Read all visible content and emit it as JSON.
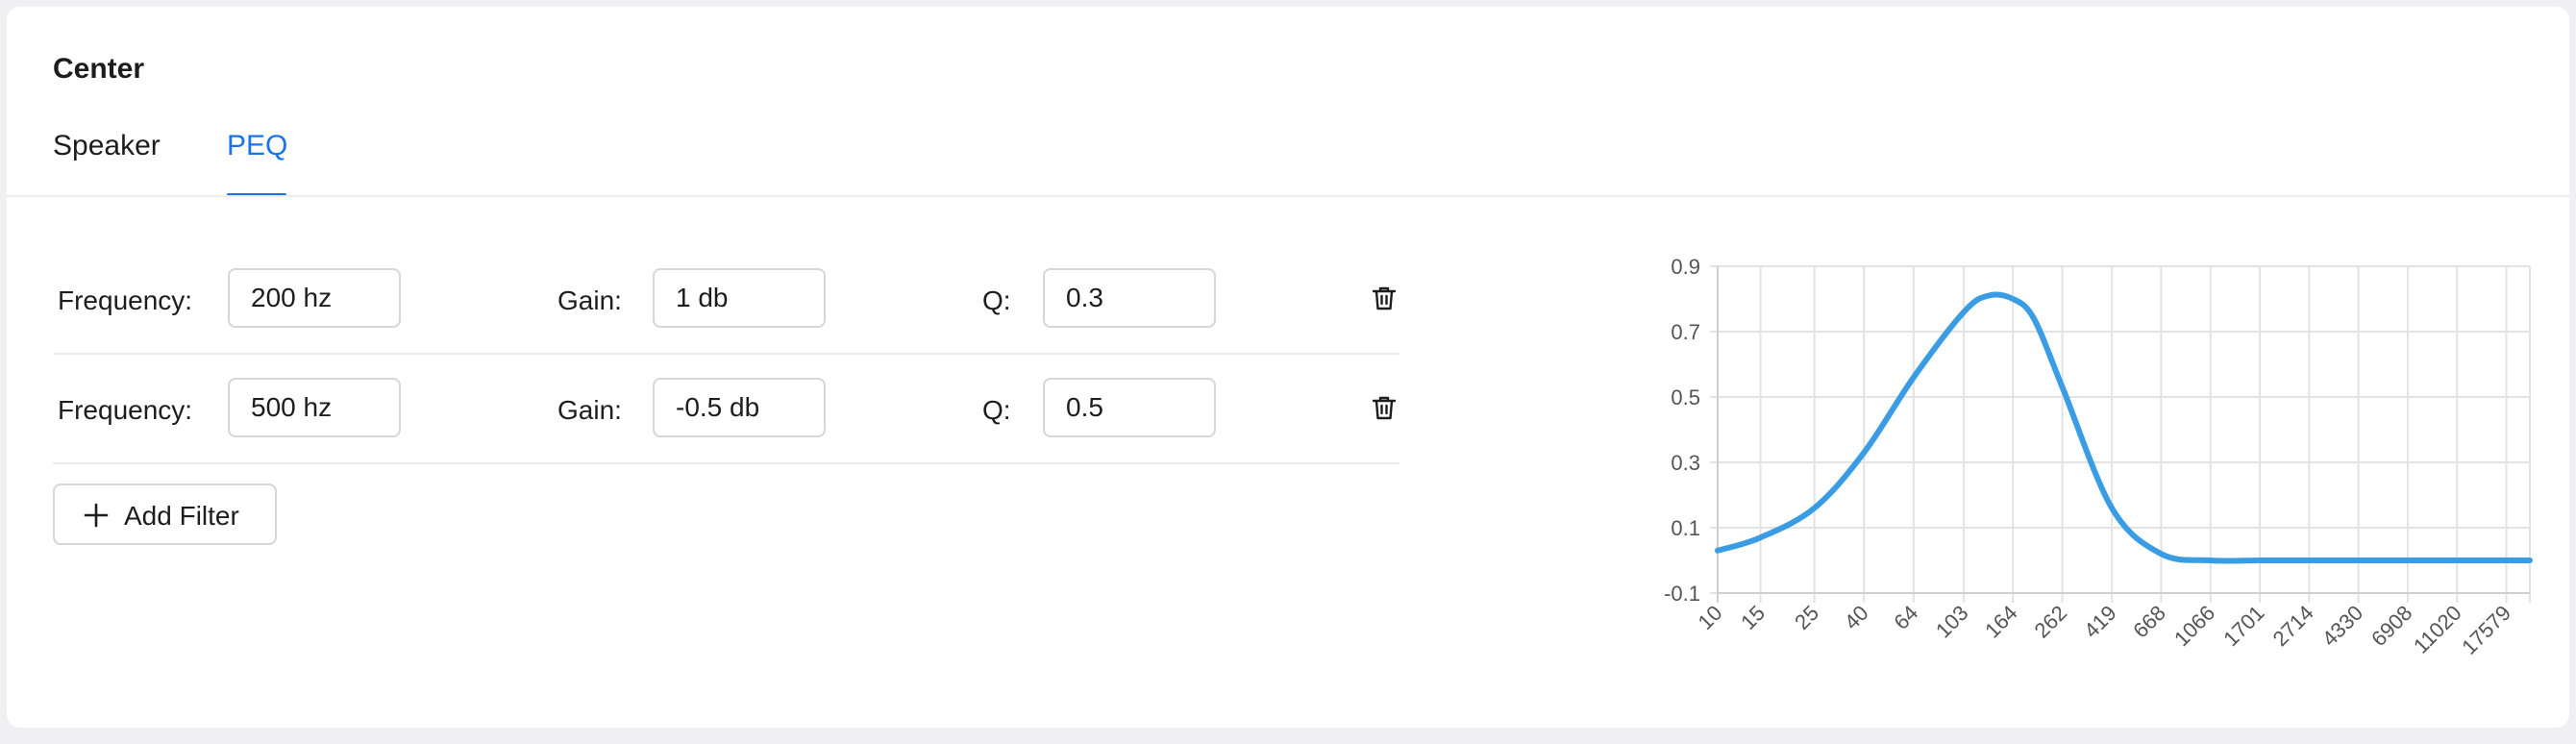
{
  "card": {
    "title": "Center"
  },
  "tabs": [
    {
      "label": "Speaker",
      "active": false
    },
    {
      "label": "PEQ",
      "active": true
    }
  ],
  "filters": [
    {
      "frequency_label": "Frequency:",
      "frequency_value": "200 hz",
      "gain_label": "Gain:",
      "gain_value": "1 db",
      "q_label": "Q:",
      "q_value": "0.3",
      "delete_icon": "trash-icon"
    },
    {
      "frequency_label": "Frequency:",
      "frequency_value": "500 hz",
      "gain_label": "Gain:",
      "gain_value": "-0.5 db",
      "q_label": "Q:",
      "q_value": "0.5",
      "delete_icon": "trash-icon"
    }
  ],
  "add_filter": {
    "label": "Add Filter",
    "icon": "plus-icon"
  },
  "colors": {
    "accent": "#1a73e8",
    "curve": "#3a9de4",
    "grid": "#e3e3e3",
    "axis_text": "#555555"
  },
  "chart_data": {
    "type": "line",
    "title": "",
    "xlabel": "",
    "ylabel": "",
    "x_scale": "log",
    "grid": true,
    "x_ticks": [
      "10",
      "15",
      "25",
      "40",
      "64",
      "103",
      "164",
      "262",
      "419",
      "668",
      "1066",
      "1701",
      "2714",
      "4330",
      "6908",
      "11020",
      "17579"
    ],
    "y_ticks": [
      "0.9",
      "0.7",
      "0.5",
      "0.3",
      "0.1",
      "-0.1"
    ],
    "ylim": [
      -0.1,
      0.9
    ],
    "series": [
      {
        "x": [
          10,
          15,
          25,
          40,
          64,
          103,
          130,
          164,
          200,
          262,
          419,
          668,
          1066,
          1701,
          2714,
          4330,
          6908,
          11020,
          17579,
          22000
        ],
        "y": [
          0.03,
          0.07,
          0.16,
          0.33,
          0.56,
          0.76,
          0.81,
          0.8,
          0.74,
          0.53,
          0.16,
          0.02,
          0.0,
          0.0,
          0.0,
          0.0,
          0.0,
          0.0,
          0.0,
          0.0
        ]
      }
    ]
  }
}
